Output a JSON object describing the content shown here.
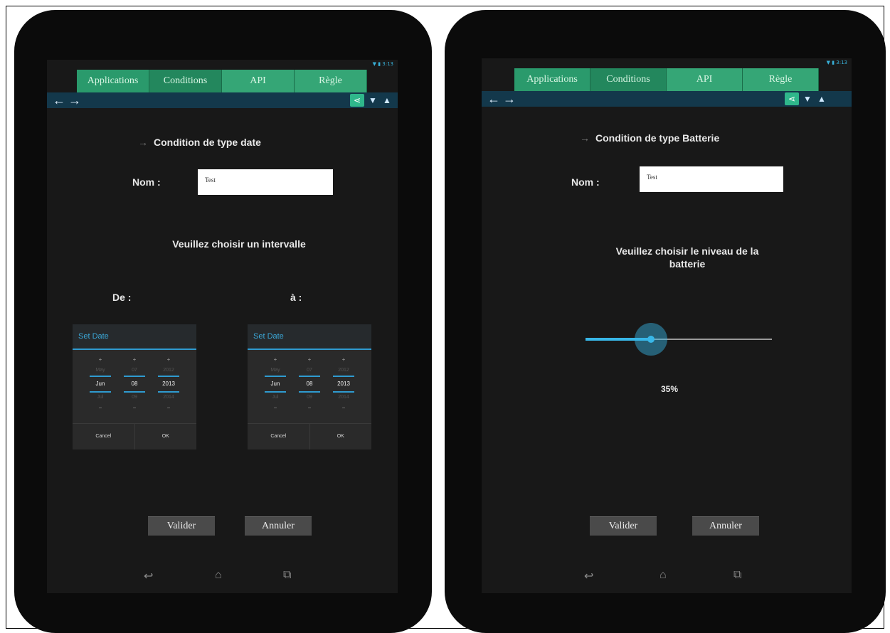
{
  "tabs": [
    "Applications",
    "Conditions",
    "API",
    "Règle"
  ],
  "status": "▼ ▮ 3:13",
  "left": {
    "title": "Condition de type date",
    "name_label": "Nom :",
    "name_value": "Test",
    "prompt": "Veuillez choisir un intervalle",
    "from_label": "De :",
    "to_label": "à :",
    "picker_from": {
      "title": "Set Date",
      "columns": [
        {
          "prev": "May",
          "selected": "Jun",
          "next": "Jul"
        },
        {
          "prev": "07",
          "selected": "08",
          "next": "09"
        },
        {
          "prev": "2012",
          "selected": "2013",
          "next": "2014"
        }
      ],
      "cancel": "Cancel",
      "ok": "OK"
    },
    "picker_to": {
      "title": "Set Date",
      "columns": [
        {
          "prev": "May",
          "selected": "Jun",
          "next": "Jul"
        },
        {
          "prev": "07",
          "selected": "08",
          "next": "09"
        },
        {
          "prev": "2012",
          "selected": "2013",
          "next": "2014"
        }
      ],
      "cancel": "Cancel",
      "ok": "OK"
    },
    "validate": "Valider",
    "cancel": "Annuler"
  },
  "right": {
    "title": "Condition de type Batterie",
    "name_label": "Nom :",
    "name_value": "Test",
    "prompt_line1": "Veuillez choisir le niveau de la",
    "prompt_line2": "batterie",
    "battery_level": 0.35,
    "battery_text": "35%",
    "validate": "Valider",
    "cancel": "Annuler"
  },
  "icons": [
    "back-arrow-icon",
    "forward-arrow-icon",
    "share-icon",
    "thumb-down-icon",
    "thumb-up-icon",
    "nav-back-icon",
    "nav-home-icon",
    "nav-recents-icon"
  ],
  "colors": {
    "tab": "#23875d",
    "actionbar": "#13384b",
    "accent": "#38b7e8"
  }
}
